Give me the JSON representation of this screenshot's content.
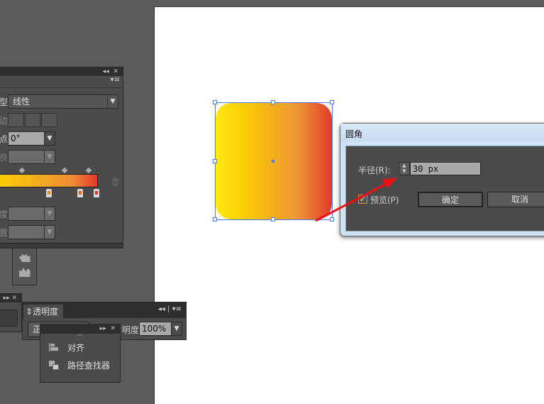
{
  "gradient_panel": {
    "type_label": "型:",
    "type_value": "线性",
    "corner_label": "边:",
    "angle_label": "点",
    "angle_value": "0°",
    "ratio_label": "良",
    "opacity_label": "度:",
    "location_label": "置:",
    "collapse": "◂◂",
    "close": "✕"
  },
  "colors": {
    "grad_start": "#fde910",
    "grad_mid": "#efa33a",
    "grad_end": "#e23a2a",
    "stop1": "#f28a1e",
    "stop2": "#ea6428",
    "stop3": "#e0302a",
    "selection": "#4a7cf6",
    "arrow": "#ee1111"
  },
  "transparency_panel": {
    "tab": "透明度",
    "mode_value": "正",
    "opacity_label": "明度:",
    "opacity_value": "100%"
  },
  "float_panel": {
    "items": [
      {
        "label": "对齐",
        "icon": "align-icon"
      },
      {
        "label": "路径查找器",
        "icon": "pathfinder-icon"
      }
    ]
  },
  "dialog": {
    "title": "圆角",
    "radius_label": "半径(R):",
    "radius_value": "30 px",
    "preview_label": "预览(P)",
    "preview_checked": true,
    "ok": "确定",
    "cancel": "取消"
  }
}
